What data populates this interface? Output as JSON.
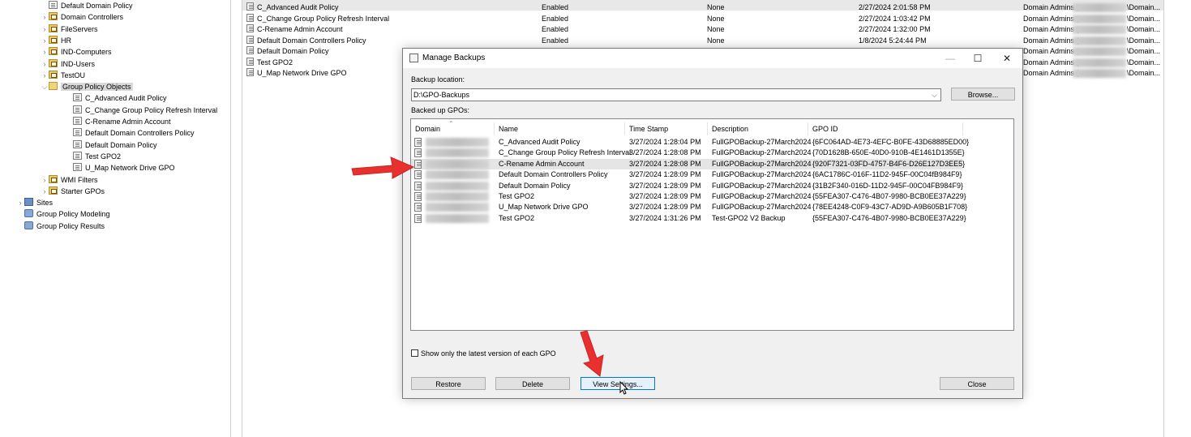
{
  "tree": {
    "items": [
      {
        "label": "Default Domain Policy",
        "icon": "gpo-link-icon",
        "chev": "",
        "indent": 1
      },
      {
        "label": "Domain Controllers",
        "icon": "ou-icon",
        "chev": ">",
        "indent": 1
      },
      {
        "label": "FileServers",
        "icon": "ou-icon",
        "chev": ">",
        "indent": 1
      },
      {
        "label": "HR",
        "icon": "ou-icon",
        "chev": ">",
        "indent": 1
      },
      {
        "label": "IND-Computers",
        "icon": "ou-icon",
        "chev": ">",
        "indent": 1
      },
      {
        "label": "IND-Users",
        "icon": "ou-icon",
        "chev": ">",
        "indent": 1
      },
      {
        "label": "TestOU",
        "icon": "ou-icon",
        "chev": ">",
        "indent": 1
      },
      {
        "label": "Group Policy Objects",
        "icon": "folder-open-icon",
        "chev": "v",
        "indent": 1
      },
      {
        "label": "C_Advanced Audit Policy",
        "icon": "gpo-icon",
        "chev": "",
        "indent": 2
      },
      {
        "label": "C_Change Group Policy Refresh Interval",
        "icon": "gpo-icon",
        "chev": "",
        "indent": 2
      },
      {
        "label": "C-Rename Admin Account",
        "icon": "gpo-icon",
        "chev": "",
        "indent": 2
      },
      {
        "label": "Default Domain Controllers Policy",
        "icon": "gpo-icon",
        "chev": "",
        "indent": 2
      },
      {
        "label": "Default Domain Policy",
        "icon": "gpo-icon",
        "chev": "",
        "indent": 2
      },
      {
        "label": "Test GPO2",
        "icon": "gpo-icon",
        "chev": "",
        "indent": 2
      },
      {
        "label": "U_Map Network Drive GPO",
        "icon": "gpo-icon",
        "chev": "",
        "indent": 2
      },
      {
        "label": "WMI Filters",
        "icon": "folder-icon",
        "chev": ">",
        "indent": 1
      },
      {
        "label": "Starter GPOs",
        "icon": "folder-icon",
        "chev": ">",
        "indent": 1
      },
      {
        "label": "Sites",
        "icon": "sites-icon",
        "chev": ">",
        "indent": 0
      },
      {
        "label": "Group Policy Modeling",
        "icon": "modeling-icon",
        "chev": "",
        "indent": 0
      },
      {
        "label": "Group Policy Results",
        "icon": "results-icon",
        "chev": "",
        "indent": 0
      }
    ]
  },
  "gpo_table": {
    "rows": [
      {
        "name": "C_Advanced Audit Policy",
        "status": "Enabled",
        "wmi": "None",
        "modified": "2/27/2024 2:01:58 PM",
        "owner": "Domain Admins (",
        "owner_end": "\\Domain..."
      },
      {
        "name": "C_Change Group Policy Refresh Interval",
        "status": "Enabled",
        "wmi": "None",
        "modified": "2/27/2024 1:03:42 PM",
        "owner": "Domain Admins (",
        "owner_end": "\\Domain..."
      },
      {
        "name": "C-Rename Admin Account",
        "status": "Enabled",
        "wmi": "None",
        "modified": "2/27/2024 1:32:00 PM",
        "owner": "Domain Admins (",
        "owner_end": "\\Domain..."
      },
      {
        "name": "Default Domain Controllers Policy",
        "status": "Enabled",
        "wmi": "None",
        "modified": "1/8/2024 5:24:44 PM",
        "owner": "Domain Admins (",
        "owner_end": "\\Domain..."
      },
      {
        "name": "Default Domain Policy",
        "status": "",
        "wmi": "",
        "modified": "",
        "owner": "Domain Admins (",
        "owner_end": "\\Domain..."
      },
      {
        "name": "Test GPO2",
        "status": "",
        "wmi": "",
        "modified": "",
        "owner": "Domain Admins (",
        "owner_end": "\\Domain..."
      },
      {
        "name": "U_Map Network Drive GPO",
        "status": "",
        "wmi": "",
        "modified": "",
        "owner": "Domain Admins (",
        "owner_end": "\\Domain..."
      }
    ]
  },
  "dialog": {
    "title": "Manage Backups",
    "minimize": "—",
    "maximize": "☐",
    "close": "✕",
    "location_label": "Backup location:",
    "location_value": "D:\\GPO-Backups",
    "browse": "Browse...",
    "list_label": "Backed up GPOs:",
    "columns": {
      "domain": "Domain",
      "name": "Name",
      "timestamp": "Time Stamp",
      "description": "Description",
      "gpoid": "GPO ID"
    },
    "backups": [
      {
        "name": "C_Advanced Audit Policy",
        "timestamp": "3/27/2024 1:28:04 PM",
        "description": "FullGPOBackup-27March2024",
        "gpoid": "{6FC064AD-4E73-4EFC-B0FE-43D68885ED00}"
      },
      {
        "name": "C_Change Group Policy Refresh Interval",
        "timestamp": "3/27/2024 1:28:08 PM",
        "description": "FullGPOBackup-27March2024",
        "gpoid": "{70D1628B-650E-40D0-910B-4E1461D1355E}"
      },
      {
        "name": "C-Rename Admin Account",
        "timestamp": "3/27/2024 1:28:08 PM",
        "description": "FullGPOBackup-27March2024",
        "gpoid": "{920F7321-03FD-4757-B4F6-D26E127D3EE5}"
      },
      {
        "name": "Default Domain Controllers Policy",
        "timestamp": "3/27/2024 1:28:09 PM",
        "description": "FullGPOBackup-27March2024",
        "gpoid": "{6AC1786C-016F-11D2-945F-00C04fB984F9}"
      },
      {
        "name": "Default Domain Policy",
        "timestamp": "3/27/2024 1:28:09 PM",
        "description": "FullGPOBackup-27March2024",
        "gpoid": "{31B2F340-016D-11D2-945F-00C04FB984F9}"
      },
      {
        "name": "Test GPO2",
        "timestamp": "3/27/2024 1:28:09 PM",
        "description": "FullGPOBackup-27March2024",
        "gpoid": "{55FEA307-C476-4B07-9980-BCB0EE37A229}"
      },
      {
        "name": "U_Map Network Drive GPO",
        "timestamp": "3/27/2024 1:28:09 PM",
        "description": "FullGPOBackup-27March2024",
        "gpoid": "{78EE4248-C0F9-43C7-AD9D-A9B605B1F708}"
      },
      {
        "name": "Test GPO2",
        "timestamp": "3/27/2024 1:31:26 PM",
        "description": "Test-GPO2 V2 Backup",
        "gpoid": "{55FEA307-C476-4B07-9980-BCB0EE37A229}"
      }
    ],
    "checkbox_label": "Show only the latest version of each GPO",
    "restore": "Restore",
    "delete": "Delete",
    "view_settings": "View Settings...",
    "close_button": "Close"
  },
  "colors": {
    "annotation_arrow": "#e8312f",
    "selection": "#e5e5e5",
    "focus_border": "#0078d7"
  }
}
